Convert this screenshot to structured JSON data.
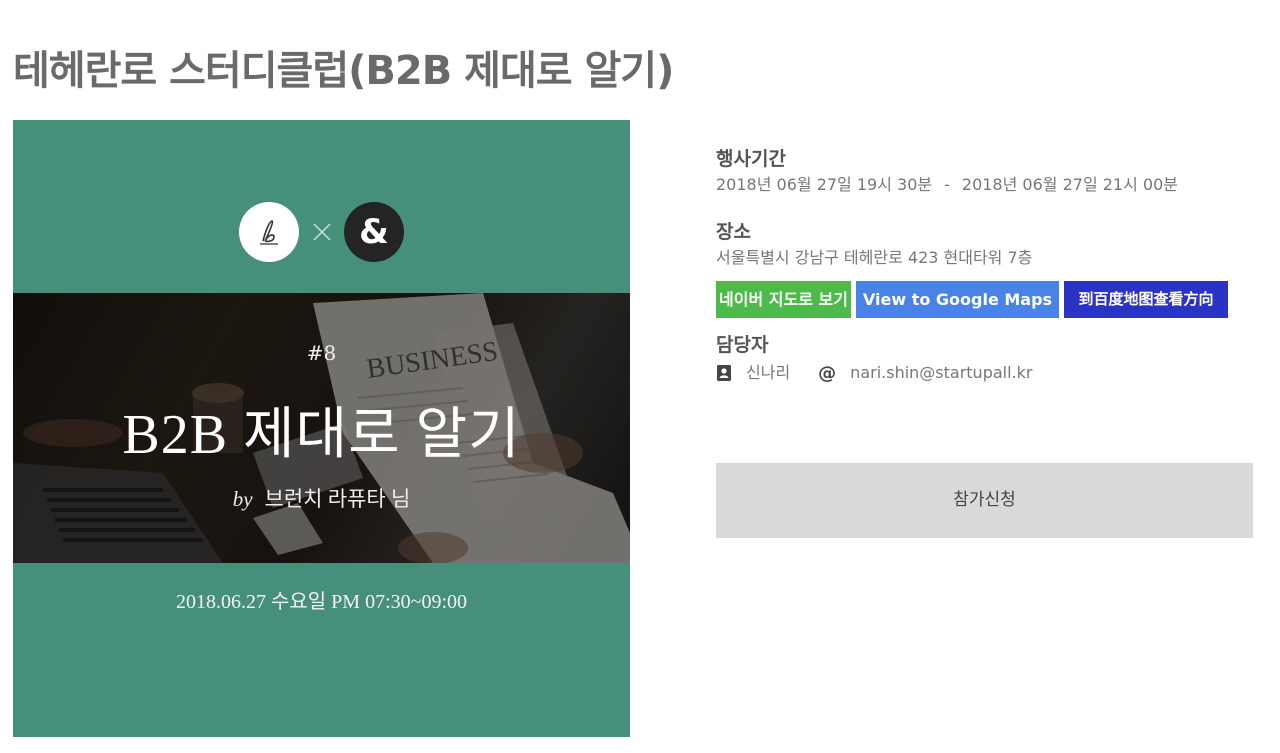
{
  "title": "테헤란로 스터디클럽(B2B 제대로 알기)",
  "poster": {
    "cross": "×",
    "amp": "&",
    "episode": "#8",
    "headline": "B2B 제대로 알기",
    "by": "by",
    "speaker": "브런치 라퓨타 님",
    "date_text": "2018.06.27 수요일 PM 07:30~09:00",
    "newspaper_text": "BUSINESS",
    "colors": {
      "background": "#468f7a"
    }
  },
  "info": {
    "period_label": "행사기간",
    "period_start": "2018년 06월 27일  19시 30분",
    "period_separator": "-",
    "period_end": "2018년 06월 27일  21시 00분",
    "place_label": "장소",
    "place_value": "서울특별시 강남구 테헤란로 423 현대타워 7층",
    "map_buttons": {
      "naver": "네이버 지도로 보기",
      "google": "View to Google Maps",
      "baidu": "到百度地图查看方向"
    },
    "contact_label": "담당자",
    "contact_name": "신나리",
    "contact_email": "nari.shin@startupall.kr",
    "contact_icons": [
      "contact-card-icon",
      "at-sign-icon"
    ]
  },
  "apply_label": "참가신청",
  "colors": {
    "naver": "#4cbb4a",
    "google": "#4a83e8",
    "baidu": "#2b33c4",
    "apply_bg": "#d9d9d9"
  }
}
